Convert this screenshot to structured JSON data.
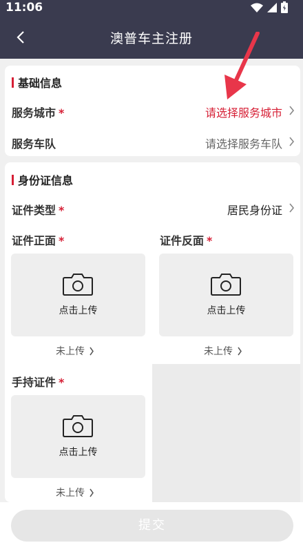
{
  "status_bar": {
    "time": "11:06"
  },
  "header": {
    "title": "澳普车主注册"
  },
  "basic_info": {
    "title": "基础信息",
    "rows": [
      {
        "label": "服务城市",
        "required": "*",
        "value": "请选择服务城市",
        "highlight": true
      },
      {
        "label": "服务车队",
        "required": "",
        "value": "请选择服务车队",
        "highlight": false
      }
    ]
  },
  "id_info": {
    "title": "身份证信息",
    "type_row": {
      "label": "证件类型",
      "required": "*",
      "value": "居民身份证"
    },
    "uploads": [
      {
        "label": "证件正面",
        "required": "*",
        "button_text": "点击上传",
        "status": "未上传"
      },
      {
        "label": "证件反面",
        "required": "*",
        "button_text": "点击上传",
        "status": "未上传"
      },
      {
        "label": "手持证件",
        "required": "*",
        "button_text": "点击上传",
        "status": "未上传"
      }
    ]
  },
  "submit": {
    "label": "提交"
  },
  "colors": {
    "header_bg": "#3a3b4f",
    "accent_red": "#d61f35",
    "arrow": "#e8364a"
  },
  "icons": [
    "back-icon",
    "wifi-icon",
    "signal-icon",
    "battery-icon",
    "camera-icon",
    "chevron-right-icon"
  ]
}
